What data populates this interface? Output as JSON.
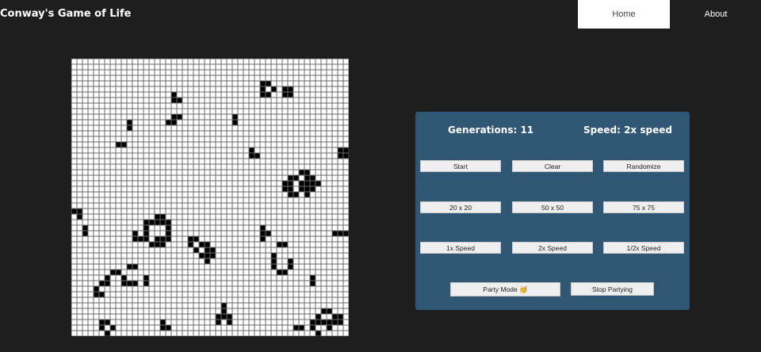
{
  "nav": {
    "brand": "Conway's Game of Life",
    "links": [
      {
        "label": "Home",
        "active": true
      },
      {
        "label": "About",
        "active": false
      }
    ]
  },
  "board": {
    "rows": 50,
    "cols": 50,
    "cell_color_alive": "#000000",
    "cell_color_dead": "#ffffff",
    "grid_color": "#6a6a6a",
    "alive_cells": [
      [
        4,
        34
      ],
      [
        4,
        35
      ],
      [
        5,
        34
      ],
      [
        5,
        36
      ],
      [
        5,
        38
      ],
      [
        5,
        39
      ],
      [
        6,
        34
      ],
      [
        6,
        35
      ],
      [
        6,
        38
      ],
      [
        6,
        39
      ],
      [
        6,
        18
      ],
      [
        7,
        18
      ],
      [
        7,
        19
      ],
      [
        10,
        18
      ],
      [
        10,
        19
      ],
      [
        11,
        17
      ],
      [
        11,
        18
      ],
      [
        10,
        29
      ],
      [
        11,
        29
      ],
      [
        11,
        10
      ],
      [
        12,
        10
      ],
      [
        15,
        8
      ],
      [
        15,
        9
      ],
      [
        16,
        32
      ],
      [
        17,
        32
      ],
      [
        17,
        33
      ],
      [
        16,
        48
      ],
      [
        16,
        49
      ],
      [
        17,
        48
      ],
      [
        17,
        49
      ],
      [
        20,
        41
      ],
      [
        20,
        42
      ],
      [
        21,
        39
      ],
      [
        21,
        40
      ],
      [
        21,
        42
      ],
      [
        21,
        43
      ],
      [
        22,
        38
      ],
      [
        22,
        39
      ],
      [
        22,
        41
      ],
      [
        22,
        42
      ],
      [
        22,
        43
      ],
      [
        22,
        44
      ],
      [
        23,
        38
      ],
      [
        23,
        39
      ],
      [
        23,
        41
      ],
      [
        23,
        42
      ],
      [
        23,
        43
      ],
      [
        24,
        39
      ],
      [
        24,
        40
      ],
      [
        24,
        42
      ],
      [
        27,
        0
      ],
      [
        27,
        1
      ],
      [
        28,
        1
      ],
      [
        28,
        15
      ],
      [
        28,
        16
      ],
      [
        29,
        13
      ],
      [
        29,
        14
      ],
      [
        29,
        15
      ],
      [
        29,
        16
      ],
      [
        29,
        17
      ],
      [
        30,
        13
      ],
      [
        30,
        17
      ],
      [
        31,
        11
      ],
      [
        31,
        13
      ],
      [
        31,
        17
      ],
      [
        32,
        11
      ],
      [
        32,
        12
      ],
      [
        32,
        13
      ],
      [
        32,
        15
      ],
      [
        32,
        16
      ],
      [
        32,
        17
      ],
      [
        33,
        14
      ],
      [
        33,
        15
      ],
      [
        33,
        16
      ],
      [
        30,
        2
      ],
      [
        31,
        2
      ],
      [
        30,
        34
      ],
      [
        31,
        34
      ],
      [
        31,
        35
      ],
      [
        32,
        34
      ],
      [
        31,
        47
      ],
      [
        31,
        48
      ],
      [
        31,
        49
      ],
      [
        32,
        21
      ],
      [
        32,
        22
      ],
      [
        33,
        21
      ],
      [
        33,
        23
      ],
      [
        33,
        24
      ],
      [
        34,
        22
      ],
      [
        34,
        24
      ],
      [
        34,
        25
      ],
      [
        35,
        23
      ],
      [
        35,
        24
      ],
      [
        35,
        25
      ],
      [
        36,
        24
      ],
      [
        33,
        37
      ],
      [
        33,
        38
      ],
      [
        35,
        36
      ],
      [
        36,
        36
      ],
      [
        37,
        36
      ],
      [
        36,
        39
      ],
      [
        37,
        39
      ],
      [
        38,
        37
      ],
      [
        38,
        38
      ],
      [
        37,
        10
      ],
      [
        37,
        11
      ],
      [
        39,
        9
      ],
      [
        40,
        9
      ],
      [
        39,
        13
      ],
      [
        40,
        13
      ],
      [
        38,
        7
      ],
      [
        38,
        8
      ],
      [
        39,
        6
      ],
      [
        40,
        5
      ],
      [
        40,
        6
      ],
      [
        41,
        4
      ],
      [
        42,
        4
      ],
      [
        42,
        5
      ],
      [
        39,
        43
      ],
      [
        40,
        43
      ],
      [
        40,
        10
      ],
      [
        40,
        11
      ],
      [
        44,
        27
      ],
      [
        45,
        27
      ],
      [
        46,
        26
      ],
      [
        46,
        27
      ],
      [
        46,
        28
      ],
      [
        47,
        26
      ],
      [
        47,
        28
      ],
      [
        45,
        45
      ],
      [
        45,
        46
      ],
      [
        46,
        44
      ],
      [
        46,
        47
      ],
      [
        47,
        43
      ],
      [
        47,
        44
      ],
      [
        47,
        45
      ],
      [
        47,
        46
      ],
      [
        47,
        47
      ],
      [
        48,
        43
      ],
      [
        48,
        46
      ],
      [
        49,
        44
      ],
      [
        46,
        48
      ],
      [
        47,
        48
      ],
      [
        47,
        5
      ],
      [
        47,
        6
      ],
      [
        48,
        5
      ],
      [
        48,
        7
      ],
      [
        49,
        6
      ],
      [
        47,
        16
      ],
      [
        48,
        16
      ],
      [
        48,
        17
      ],
      [
        48,
        40
      ],
      [
        48,
        41
      ]
    ]
  },
  "controls": {
    "generations": "Generations: 11",
    "speed": "Speed: 2x speed",
    "buttons": {
      "start": "Start",
      "clear": "Clear",
      "randomize": "Randomize",
      "size_20": "20 x 20",
      "size_50": "50 x 50",
      "size_75": "75 x 75",
      "speed_1x": "1x Speed",
      "speed_2x": "2x Speed",
      "speed_half": "1/2x Speed",
      "party_mode": "Party Mode 🥳",
      "stop_partying": "Stop Partying"
    }
  },
  "colors": {
    "background": "#1e1e1e",
    "panel": "#2f5673",
    "nav_active": "#ffffff"
  }
}
